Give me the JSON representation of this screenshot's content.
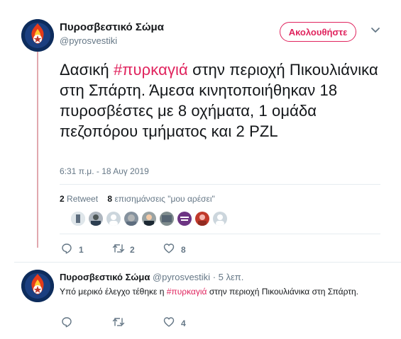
{
  "main_tweet": {
    "author_name": "Πυροσβεστικό Σώμα",
    "author_handle": "@pyrosvestiki",
    "follow_label": "Ακολουθήστε",
    "text_before": "Δασική ",
    "hashtag": "#πυρκαγιά",
    "text_after": " στην περιοχή Πικουλιάνικα στη Σπάρτη. Άμεσα κινητοποιήθηκαν 18 πυροσβέστες με 8 οχήματα, 1 ομάδα πεζοπόρου τμήματος και 2 PZL",
    "timestamp": "6:31 π.μ. - 18 Αυγ 2019",
    "retweets_count": "2",
    "retweets_label": "Retweet",
    "likes_count": "8",
    "likes_label": "επισημάνσεις \"μου αρέσει\"",
    "actions": {
      "reply_count": "1",
      "retweet_count": "2",
      "like_count": "8"
    }
  },
  "reply_tweet": {
    "author_name": "Πυροσβεστικό Σώμα",
    "author_handle": "@pyrosvestiki",
    "time_sep": " · ",
    "time": "5 λεπ.",
    "text_before": "Υπό μερικό έλεγχο τέθηκε η ",
    "hashtag": "#πυρκαγιά",
    "text_after": " στην περιοχή Πικουλιάνικα στη Σπάρτη.",
    "actions": {
      "reply_count": "",
      "retweet_count": "",
      "like_count": "4"
    }
  },
  "colors": {
    "accent": "#e0245e",
    "thread_line": "#e1a8ae",
    "muted": "#657786"
  },
  "icons": [
    "reply-icon",
    "retweet-icon",
    "like-icon",
    "chevron-down-icon"
  ]
}
